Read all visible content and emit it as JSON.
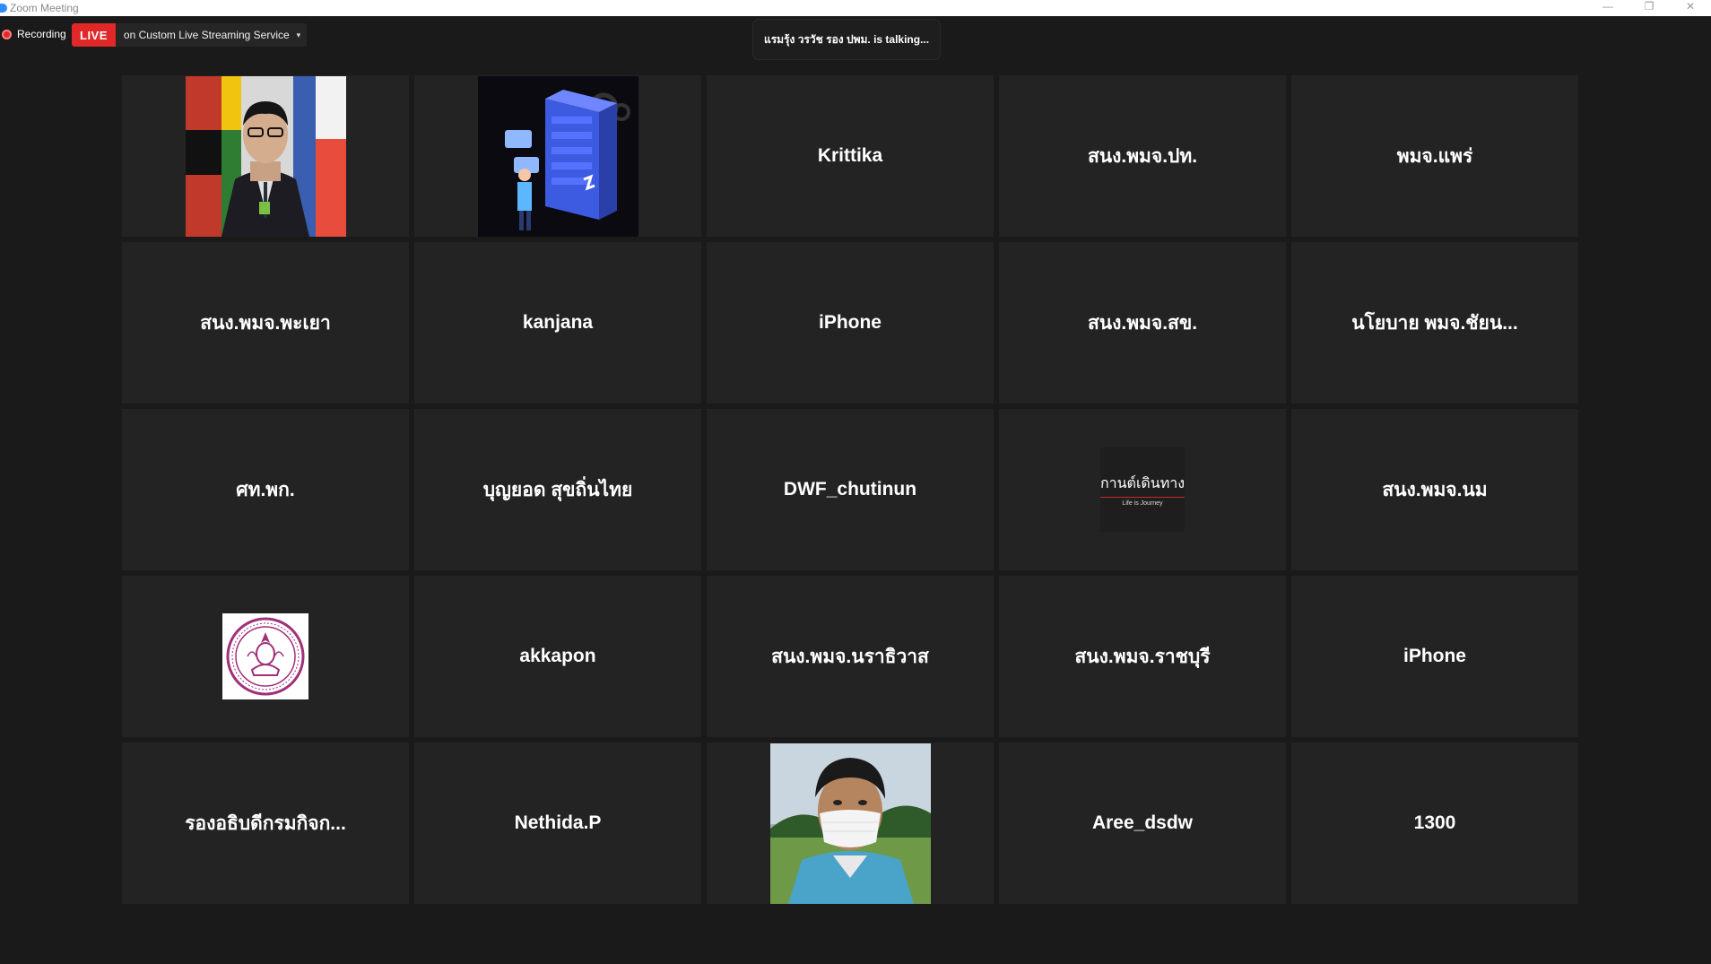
{
  "window": {
    "title": "Zoom Meeting",
    "controls": {
      "minimize": "—",
      "restore": "❐",
      "close": "✕"
    }
  },
  "topbar": {
    "recording_label": "Recording",
    "live_badge": "LIVE",
    "live_service": "on Custom Live Streaming Service",
    "live_caret": "▾",
    "talking_text": "แรมรุ้ง วรวัช รอง ปพม. is  talking..."
  },
  "colors": {
    "background": "#1a1a1a",
    "tile": "#232323",
    "live_red": "#e02828",
    "text": "#ffffff"
  },
  "tiles": [
    {
      "name": "",
      "picture": "person-photo-flags"
    },
    {
      "name": "",
      "picture": "server-illustration"
    },
    {
      "name": "Krittika"
    },
    {
      "name": "สนง.พมจ.ปท."
    },
    {
      "name": "พมจ.แพร่"
    },
    {
      "name": "สนง.พมจ.พะเยา"
    },
    {
      "name": "kanjana"
    },
    {
      "name": "iPhone"
    },
    {
      "name": "สนง.พมจ.สข."
    },
    {
      "name": "นโยบาย พมจ.ชัยน..."
    },
    {
      "name": "ศท.พก."
    },
    {
      "name": "บุญยอด สุขถิ่นไทย"
    },
    {
      "name": "DWF_chutinun"
    },
    {
      "name": "",
      "picture": "brand-logo",
      "brand_main": "กานต์เดินทาง",
      "brand_sub": "Life is Journey"
    },
    {
      "name": "สนง.พมจ.นม"
    },
    {
      "name": "",
      "picture": "emblem-seal"
    },
    {
      "name": "akkapon"
    },
    {
      "name": "สนง.พมจ.นราธิวาส"
    },
    {
      "name": "สนง.พมจ.ราชบุรี"
    },
    {
      "name": "iPhone"
    },
    {
      "name": "รองอธิบดีกรมกิจก..."
    },
    {
      "name": "Nethida.P"
    },
    {
      "name": "",
      "picture": "person-photo-mask"
    },
    {
      "name": "Aree_dsdw"
    },
    {
      "name": "1300"
    }
  ]
}
